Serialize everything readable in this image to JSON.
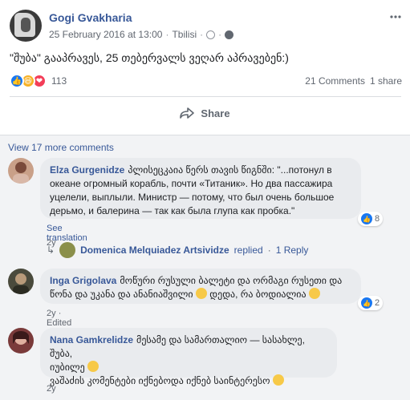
{
  "post": {
    "author": "Gogi Gvakharia",
    "date": "25 February 2016 at 13:00",
    "separator": "·",
    "location": "Tbilisi",
    "text": "\"შუბა\" გააპრავეს, 25 თებერვალს ვეღარ აპრავებენ:)",
    "reaction_count": "113",
    "comments_count": "21 Comments",
    "shares_count": "1 share",
    "share_label": "Share"
  },
  "comments_section": {
    "view_more": "View 17 more comments",
    "comments": [
      {
        "name": "Elza Gurgenidze",
        "text_line1": "პლისეცკაია წერს თავის წიგნში: \"...потонул в",
        "text_line2": "океане огромный корабль, почти «Титаник». Но два пассажира",
        "text_line3": "уцелели, выплыли. Министр — потому, что был очень большое",
        "text_line4": "дерьмо, и балерина — так как была глупа как пробка.\"",
        "likes": "8",
        "see_translation": "See translation",
        "time": "2y",
        "reply_author": "Domenica Melquiadez Artsividze",
        "reply_action": "replied",
        "reply_count": "1 Reply"
      },
      {
        "name": "Inga Grigolava",
        "text_line1": "მოწური რუსული ბალეტი და ორმაგი რუსეთი და",
        "text_line2": "წონა და უკანა და ანანიაშვილი",
        "text_line2b": "დედა, რა ბოდიალია",
        "likes": "2",
        "time": "2y",
        "edited": "Edited"
      },
      {
        "name": "Nana Gamkrelidze",
        "text_line1": "მესამე და სამართალიო — სასახლე, შუბა,",
        "text_line2": "იუბილე",
        "text_line3": "ვაშაძის კომენტები იქნებოდა იქნებ საინტერესო",
        "time": "2y"
      }
    ]
  },
  "colors": {
    "link": "#385898",
    "like": "#1877f2",
    "bg": "#f2f3f5"
  }
}
